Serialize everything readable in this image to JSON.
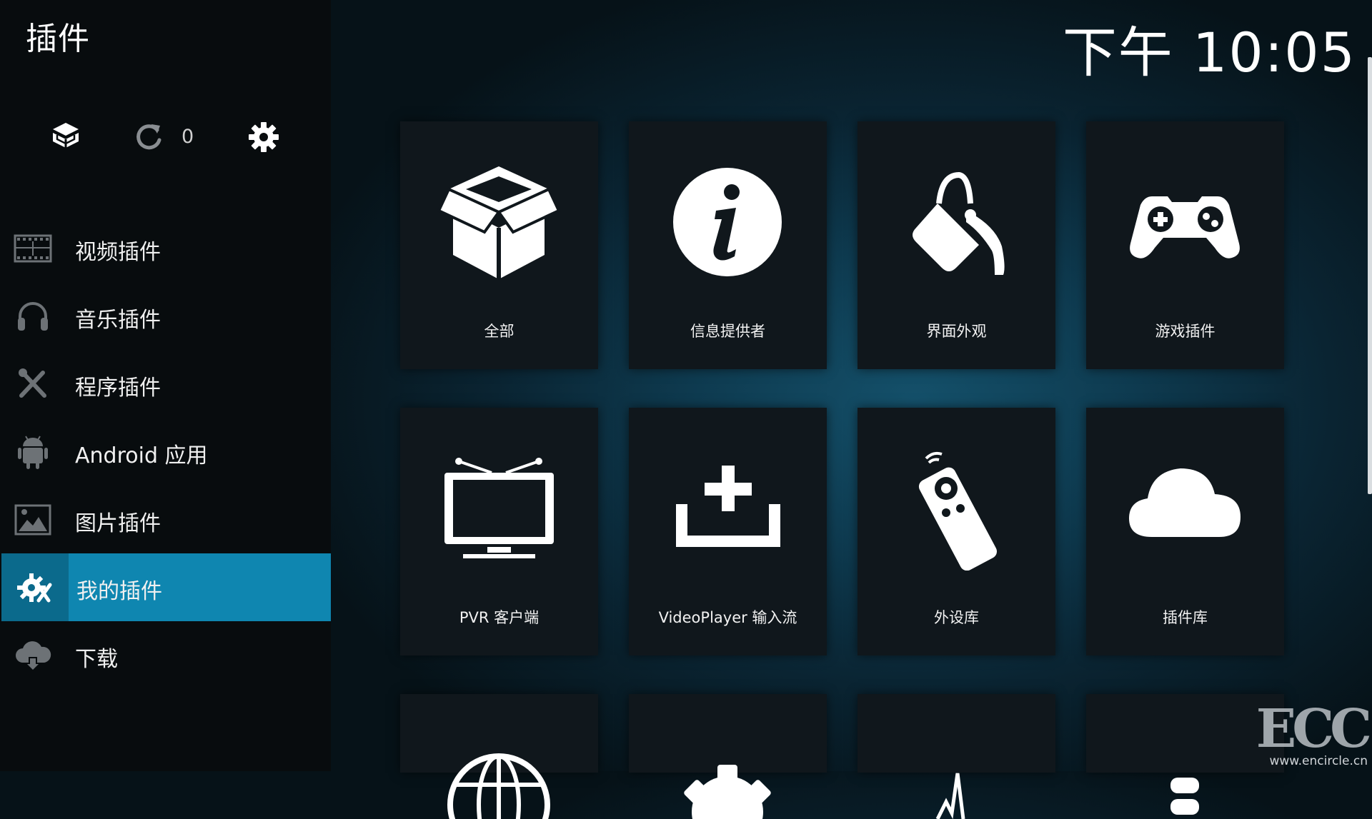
{
  "page_title": "插件",
  "clock": "下午 10:05",
  "top_controls": {
    "update_count": "0"
  },
  "menu": [
    {
      "label": "视频插件",
      "icon": "film-icon"
    },
    {
      "label": "音乐插件",
      "icon": "headphones-icon"
    },
    {
      "label": "程序插件",
      "icon": "tools-icon"
    },
    {
      "label": "Android 应用",
      "icon": "android-icon"
    },
    {
      "label": "图片插件",
      "icon": "picture-icon"
    },
    {
      "label": "我的插件",
      "icon": "addon-gears-icon",
      "active": true
    },
    {
      "label": "下载",
      "icon": "cloud-download-icon"
    }
  ],
  "tiles": [
    {
      "label": "全部",
      "icon": "open-box-icon"
    },
    {
      "label": "信息提供者",
      "icon": "info-icon"
    },
    {
      "label": "界面外观",
      "icon": "paint-bucket-icon"
    },
    {
      "label": "游戏插件",
      "icon": "gamepad-icon"
    },
    {
      "label": "PVR 客户端",
      "icon": "tv-icon"
    },
    {
      "label": "VideoPlayer 输入流",
      "icon": "input-stream-icon"
    },
    {
      "label": "外设库",
      "icon": "remote-icon"
    },
    {
      "label": "插件库",
      "icon": "cloud-icon"
    }
  ],
  "partial_tiles": [
    {
      "icon": "globe-icon"
    },
    {
      "icon": "gear-icon"
    },
    {
      "icon": "waveform-icon"
    },
    {
      "icon": "stack-icon"
    }
  ],
  "watermark": {
    "logo": "ECC",
    "url": "www.encircle.cn"
  },
  "colors": {
    "active": "#0f86b0",
    "sidebar": "#080c0e",
    "tile": "#10171c"
  }
}
